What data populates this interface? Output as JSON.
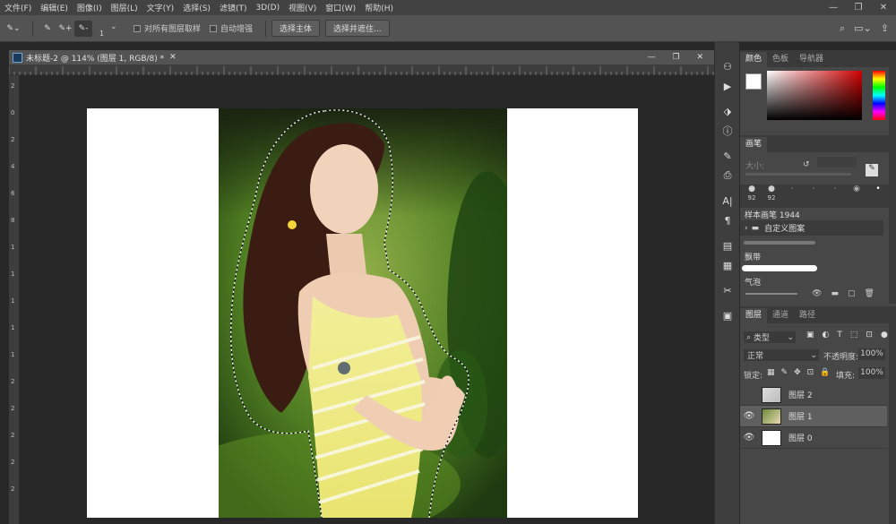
{
  "menu": [
    "文件(F)",
    "编辑(E)",
    "图像(I)",
    "图层(L)",
    "文字(Y)",
    "选择(S)",
    "滤镜(T)",
    "3D(D)",
    "视图(V)",
    "窗口(W)",
    "帮助(H)"
  ],
  "options": {
    "size": "1",
    "sample_all": "对所有图层取样",
    "auto_enhance": "自动增强",
    "select_subject": "选择主体",
    "select_mask": "选择并遮住..."
  },
  "document": {
    "title": "未标题-2 @ 114% (图层 1, RGB/8) *"
  },
  "ruler_v": [
    "2",
    "0",
    "2",
    "4",
    "6",
    "8",
    "1",
    "1",
    "1",
    "1",
    "1",
    "2",
    "2",
    "2",
    "2",
    "2"
  ],
  "color_panel": {
    "tabs": [
      "颜色",
      "色板",
      "导航器"
    ],
    "fg": "#ffffff",
    "bg": "#000000",
    "hue": "#d10000"
  },
  "brush_panel": {
    "tab": "画笔",
    "size_label": "大小:",
    "presets": [
      "92",
      "92"
    ],
    "sample_label": "样本画笔 1944",
    "group": "自定义图案",
    "brush1": "飘带",
    "brush2": "气泡"
  },
  "layers_panel": {
    "tabs": [
      "图层",
      "通道",
      "路径"
    ],
    "filter": "类型",
    "blend": "正常",
    "opacity_label": "不透明度:",
    "opacity": "100%",
    "lock_label": "锁定:",
    "fill_label": "填充:",
    "fill": "100%",
    "layers": [
      {
        "name": "图层 2",
        "visible": false
      },
      {
        "name": "图层 1",
        "visible": true
      },
      {
        "name": "图层 0",
        "visible": true
      }
    ]
  }
}
